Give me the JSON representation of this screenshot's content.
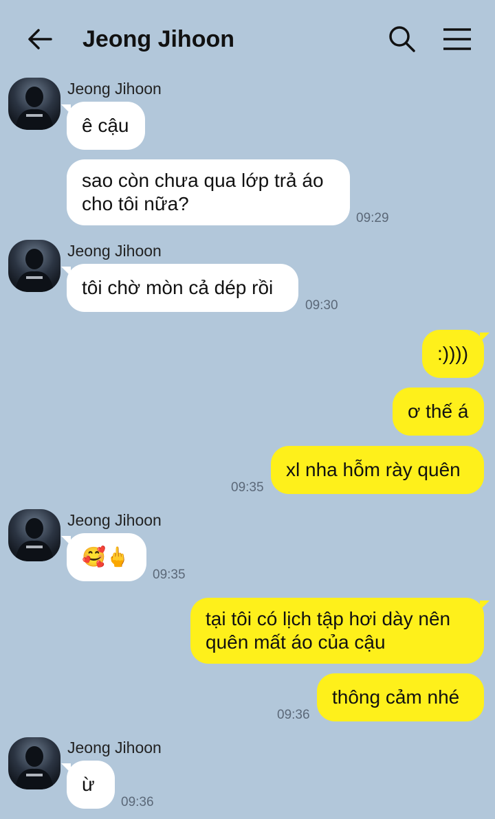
{
  "header": {
    "title": "Jeong Jihoon",
    "back_icon": "arrow-left-icon",
    "search_icon": "search-icon",
    "menu_icon": "hamburger-menu-icon"
  },
  "colors": {
    "background": "#b2c7da",
    "incoming_bubble": "#ffffff",
    "outgoing_bubble": "#fef01b"
  },
  "messages": [
    {
      "sender": "Jeong Jihoon",
      "direction": "in",
      "text": "ê cậu"
    },
    {
      "direction": "in",
      "text": "sao còn chưa qua lớp trả áo cho tôi nữa?",
      "time": "09:29"
    },
    {
      "sender": "Jeong Jihoon",
      "direction": "in",
      "text": "tôi chờ mòn cả dép rồi",
      "time": "09:30"
    },
    {
      "direction": "out",
      "text": ":))))"
    },
    {
      "direction": "out",
      "text": "ơ thế á"
    },
    {
      "direction": "out",
      "text": "xl nha hỗm rày quên",
      "time": "09:35"
    },
    {
      "sender": "Jeong Jihoon",
      "direction": "in",
      "text": "🥰🖕",
      "time": "09:35"
    },
    {
      "direction": "out",
      "text": "tại tôi có lịch tập hơi dày nên quên mất áo của cậu"
    },
    {
      "direction": "out",
      "text": "thông cảm nhé",
      "time": "09:36"
    },
    {
      "sender": "Jeong Jihoon",
      "direction": "in",
      "text": "ừ",
      "time": "09:36"
    }
  ]
}
